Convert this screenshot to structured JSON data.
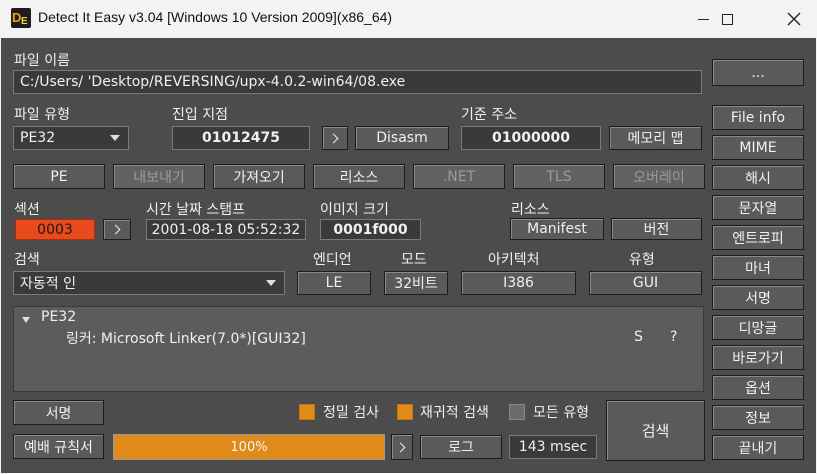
{
  "window": {
    "title": "Detect It Easy v3.04 [Windows 10 Version 2009](x86_64)",
    "icon": "die-app-icon",
    "icon_letters": [
      "D",
      "E"
    ]
  },
  "file": {
    "name_label": "파일 이름",
    "path": "C:/Users/      'Desktop/REVERSING/upx-4.0.2-win64/08.exe",
    "browse_label": "..."
  },
  "info": {
    "file_type_label": "파일 유형",
    "file_type_value": "PE32",
    "entry_point_label": "진입 지점",
    "entry_point_value": "01012475",
    "disasm_label": "Disasm",
    "base_address_label": "기준 주소",
    "base_address_value": "01000000",
    "memory_map_label": "메모리 맵"
  },
  "tabs": {
    "pe": "PE",
    "export": "내보내기",
    "import": "가져오기",
    "resources": "리소스",
    "net": ".NET",
    "tls": "TLS",
    "overlay": "오버레이"
  },
  "details": {
    "sections_label": "섹션",
    "sections_value": "0003",
    "timestamp_label": "시간 날짜 스탬프",
    "timestamp_value": "2001-08-18 05:52:32",
    "image_size_label": "이미지 크기",
    "image_size_value": "0001f000",
    "resources_label": "리소스",
    "manifest_label": "Manifest",
    "version_label": "버전"
  },
  "scan": {
    "search_label": "검색",
    "search_mode": "자동적 인",
    "endianness_label": "엔디언",
    "endianness_value": "LE",
    "mode_label": "모드",
    "mode_value": "32비트",
    "arch_label": "아키텍처",
    "arch_value": "I386",
    "type_label": "유형",
    "type_value": "GUI"
  },
  "results": {
    "group": "PE32",
    "entries": [
      {
        "text": "링커: Microsoft Linker(7.0*)[GUI32]",
        "flag": "S",
        "help": "?"
      }
    ]
  },
  "bottom": {
    "signatures_label": "서명",
    "exclusion_rules_label": "예배 규칙서",
    "deep_scan_label": "정밀 검사",
    "deep_scan_checked": true,
    "recursive_scan_label": "재귀적 검색",
    "recursive_scan_checked": true,
    "all_types_label": "모든 유형",
    "all_types_checked": false,
    "progress_text": "100%",
    "progress_value": 1.0,
    "log_label": "로그",
    "elapsed": "143 msec",
    "scan_label": "검색"
  },
  "side_menu": [
    "File info",
    "MIME",
    "해시",
    "문자열",
    "엔트로피",
    "마녀",
    "서명",
    "디망글",
    "바로가기",
    "옵션",
    "정보",
    "끝내기"
  ],
  "colors": {
    "accent_orange": "#e08a1a",
    "sections_red": "#e84a1c",
    "panel_bg": "#4c4c4c"
  }
}
